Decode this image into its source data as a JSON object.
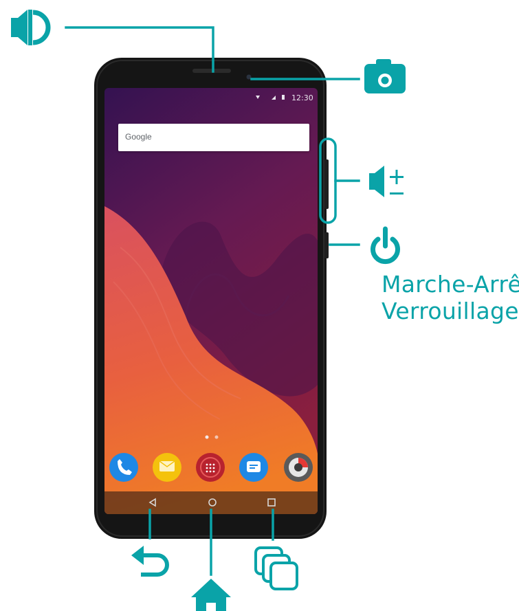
{
  "phone": {
    "status_time": "12:30",
    "search_label": "Google"
  },
  "callouts": {
    "power_label_line1": "Marche-Arrêt/",
    "power_label_line2": "Verrouillage"
  },
  "colors": {
    "accent": "#0aa3a8",
    "phone_body": "#151515",
    "screen_top": "#3a1450",
    "screen_mid": "#7a1c4a",
    "wave_coral": "#e2595a",
    "wave_orange": "#ef7a2c"
  },
  "icons": {
    "earpiece": "speaker-icon",
    "front_camera": "camera-icon",
    "volume_keys": "volume-plus-minus-icon",
    "power_key": "power-icon",
    "back_key": "back-arrow-icon",
    "home_key": "home-icon",
    "recent_apps_key": "recent-apps-icon"
  }
}
